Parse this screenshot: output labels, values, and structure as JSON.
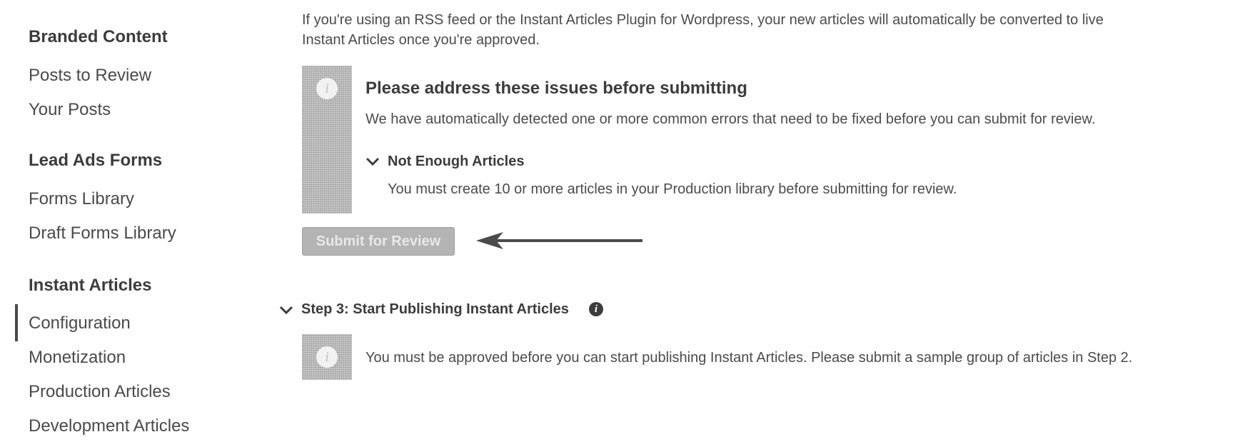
{
  "sidebar": {
    "sections": [
      {
        "heading": "Branded Content",
        "items": [
          "Posts to Review",
          "Your Posts"
        ]
      },
      {
        "heading": "Lead Ads Forms",
        "items": [
          "Forms Library",
          "Draft Forms Library"
        ]
      },
      {
        "heading": "Instant Articles",
        "items": [
          "Configuration",
          "Monetization",
          "Production Articles",
          "Development Articles"
        ]
      }
    ],
    "active_item": "Configuration"
  },
  "main": {
    "intro_line1": "If you're using an RSS feed or the Instant Articles Plugin for Wordpress, your new articles will automatically be converted to live",
    "intro_line2": "Instant Articles once you're approved.",
    "issues": {
      "icon": "info-icon",
      "title": "Please address these issues before submitting",
      "description": "We have automatically detected one or more common errors that need to be fixed before you can submit for review.",
      "items": [
        {
          "title": "Not Enough Articles",
          "detail": "You must create 10 or more articles in your Production library before submitting for review."
        }
      ]
    },
    "submit_button": {
      "label": "Submit for Review",
      "state": "disabled"
    },
    "step3": {
      "title": "Step 3: Start Publishing Instant Articles",
      "message": "You must be approved before you can start publishing Instant Articles. Please submit a sample group of articles in Step 2."
    }
  },
  "colors": {
    "arrow": "#4a4a4a",
    "disabled_button": "#b4b4b4",
    "info_strip": "#c8c8c8"
  }
}
